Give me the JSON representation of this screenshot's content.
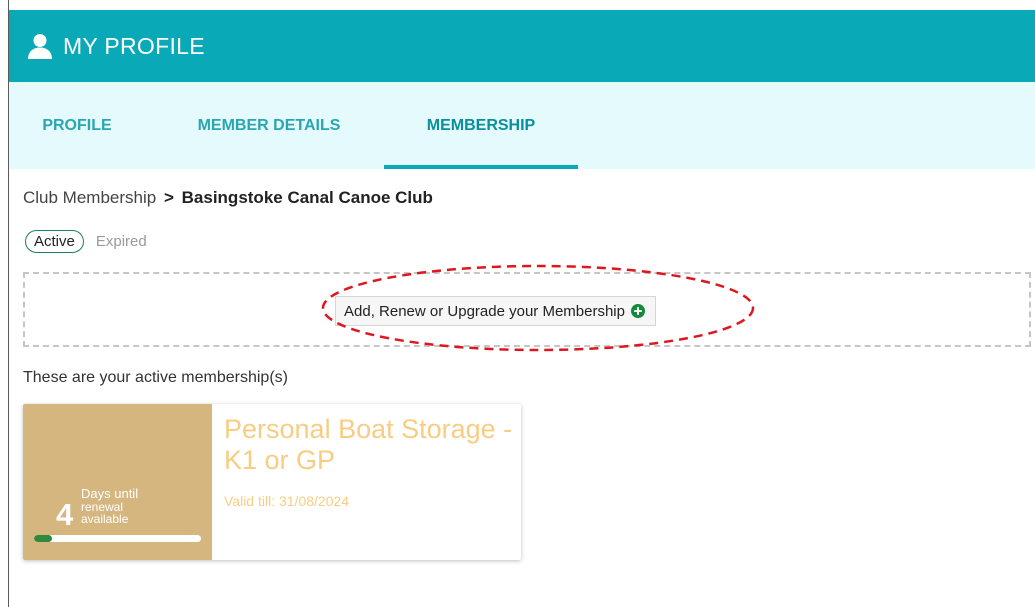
{
  "header": {
    "title": "MY PROFILE",
    "icon": "user-icon"
  },
  "tabs": [
    {
      "label": "PROFILE",
      "active": false
    },
    {
      "label": "MEMBER DETAILS",
      "active": false
    },
    {
      "label": "MEMBERSHIP",
      "active": true
    }
  ],
  "breadcrumb": {
    "parent": "Club Membership",
    "separator": ">",
    "current": "Basingstoke Canal Canoe Club"
  },
  "filters": {
    "active": "Active",
    "expired": "Expired"
  },
  "add_button": {
    "label": "Add, Renew or Upgrade your Membership",
    "icon": "plus-circle-icon"
  },
  "intro_text": "These are your active membership(s)",
  "membership_card": {
    "title": "Personal Boat Storage - K1 or GP",
    "valid": "Valid till: 31/08/2024",
    "days": "4",
    "days_line1": "Days until",
    "days_line2": "renewal",
    "days_line3": "available",
    "progress": 0.11
  },
  "colors": {
    "header_bg": "#0aa9b7",
    "tabbar_bg": "#e4fafc",
    "tab_text": "#2aa6b0",
    "card_left_bg": "#d6b67f",
    "card_title": "#f8cd83",
    "progress_fill": "#2f8a3e",
    "annotation": "#e0161e"
  }
}
